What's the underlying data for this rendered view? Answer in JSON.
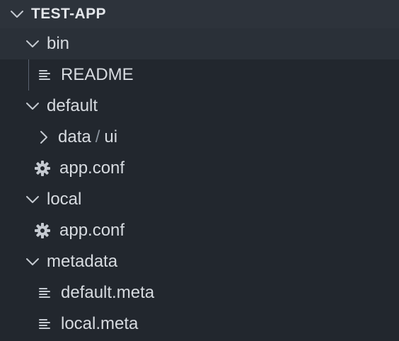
{
  "explorer": {
    "root_label": "TEST-APP",
    "items": [
      {
        "label": "bin",
        "type": "folder-open"
      },
      {
        "label": "README",
        "type": "file-text"
      },
      {
        "label": "default",
        "type": "folder-open"
      },
      {
        "label_a": "data",
        "sep": "/",
        "label_b": "ui",
        "type": "folder-closed"
      },
      {
        "label": "app.conf",
        "type": "file-gear"
      },
      {
        "label": "local",
        "type": "folder-open"
      },
      {
        "label": "app.conf",
        "type": "file-gear"
      },
      {
        "label": "metadata",
        "type": "folder-open"
      },
      {
        "label": "default.meta",
        "type": "file-text"
      },
      {
        "label": "local.meta",
        "type": "file-text"
      }
    ]
  },
  "icons": {
    "chevron_open": "chevron-down-icon",
    "chevron_closed": "chevron-right-icon",
    "file_text": "text-file-icon",
    "gear": "gear-icon"
  },
  "colors": {
    "background": "#22272e",
    "header_bg": "#2d333b",
    "selected_bg": "#2a3038",
    "text": "#d7dbe0",
    "icon": "#c5cad1",
    "guide": "#5a6270"
  }
}
